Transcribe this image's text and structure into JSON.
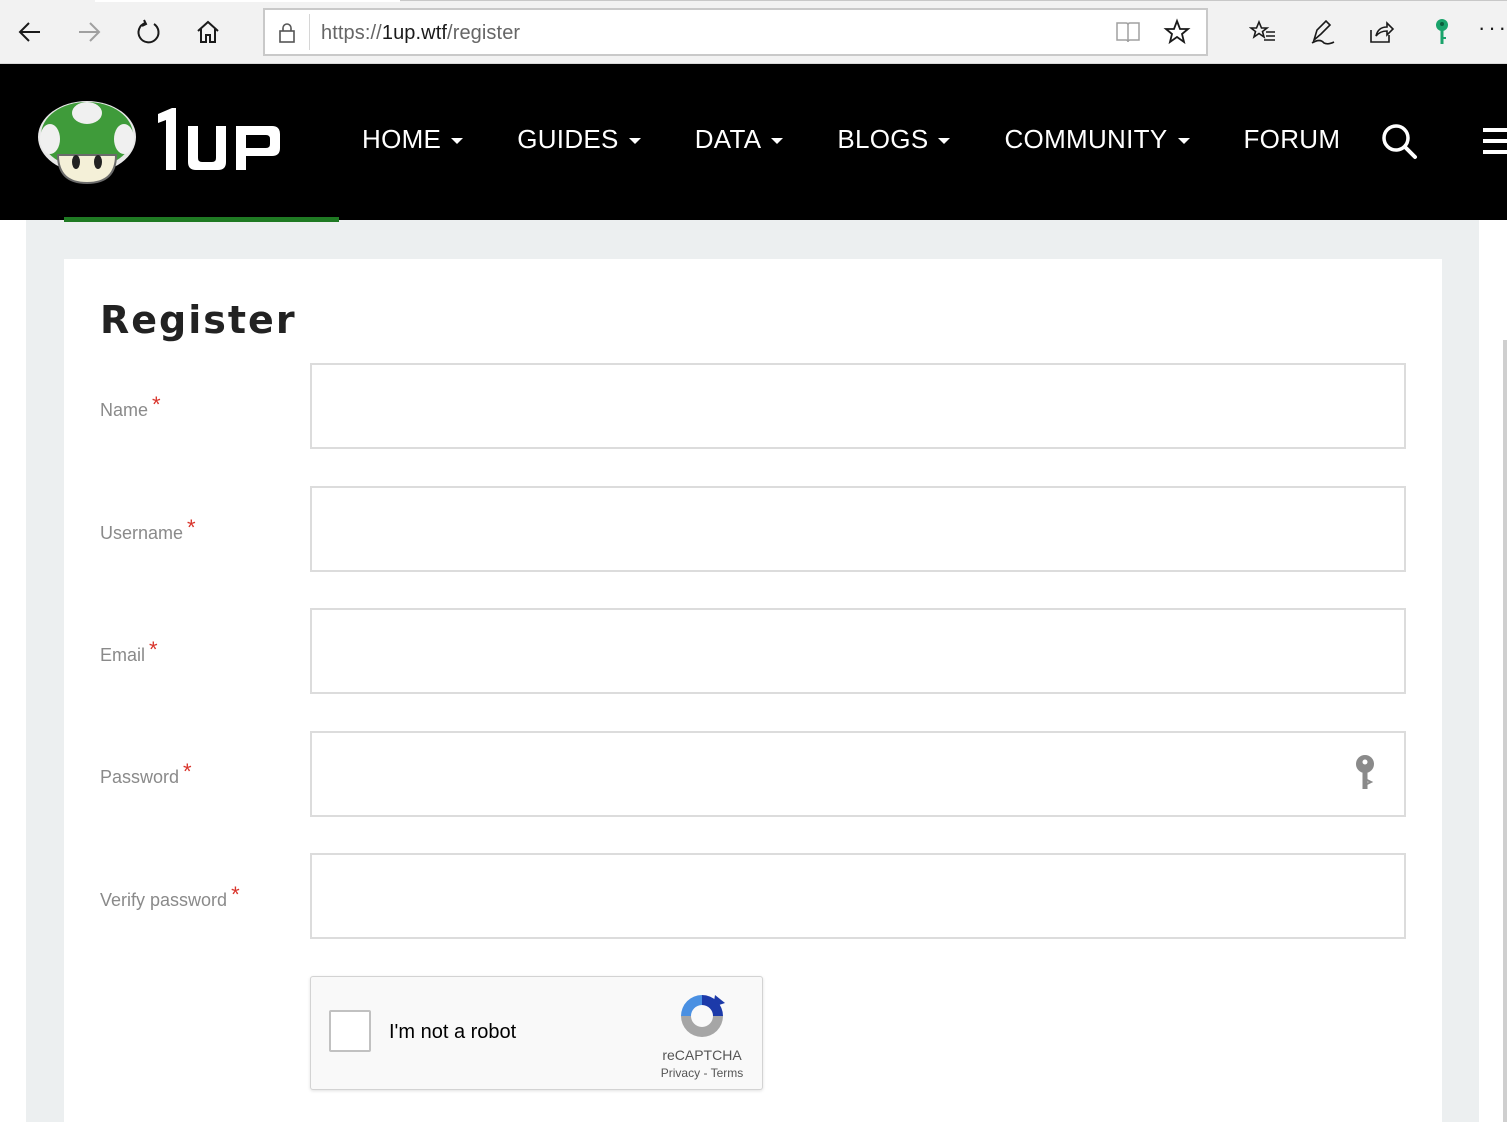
{
  "browser": {
    "url_scheme": "https://",
    "url_host": "1up.wtf",
    "url_path": "/register",
    "more_label": "···"
  },
  "site": {
    "logo_text": "1up",
    "nav": [
      {
        "label": "HOME",
        "dropdown": true
      },
      {
        "label": "GUIDES",
        "dropdown": true
      },
      {
        "label": "DATA",
        "dropdown": true
      },
      {
        "label": "BLOGS",
        "dropdown": true
      },
      {
        "label": "COMMUNITY",
        "dropdown": true
      },
      {
        "label": "FORUM",
        "dropdown": false
      }
    ],
    "accent_color": "#1f7a23"
  },
  "form": {
    "title": "Register",
    "required_marker": "*",
    "fields": {
      "name": {
        "label": "Name",
        "value": "",
        "placeholder": ""
      },
      "username": {
        "label": "Username",
        "value": "",
        "placeholder": ""
      },
      "email": {
        "label": "Email",
        "value": "",
        "placeholder": ""
      },
      "password": {
        "label": "Password",
        "value": "",
        "placeholder": ""
      },
      "verify_password": {
        "label": "Verify password",
        "value": "",
        "placeholder": ""
      }
    }
  },
  "recaptcha": {
    "label": "I'm not a robot",
    "brand": "reCAPTCHA",
    "privacy": "Privacy",
    "terms": "Terms",
    "links_sep": " - "
  }
}
